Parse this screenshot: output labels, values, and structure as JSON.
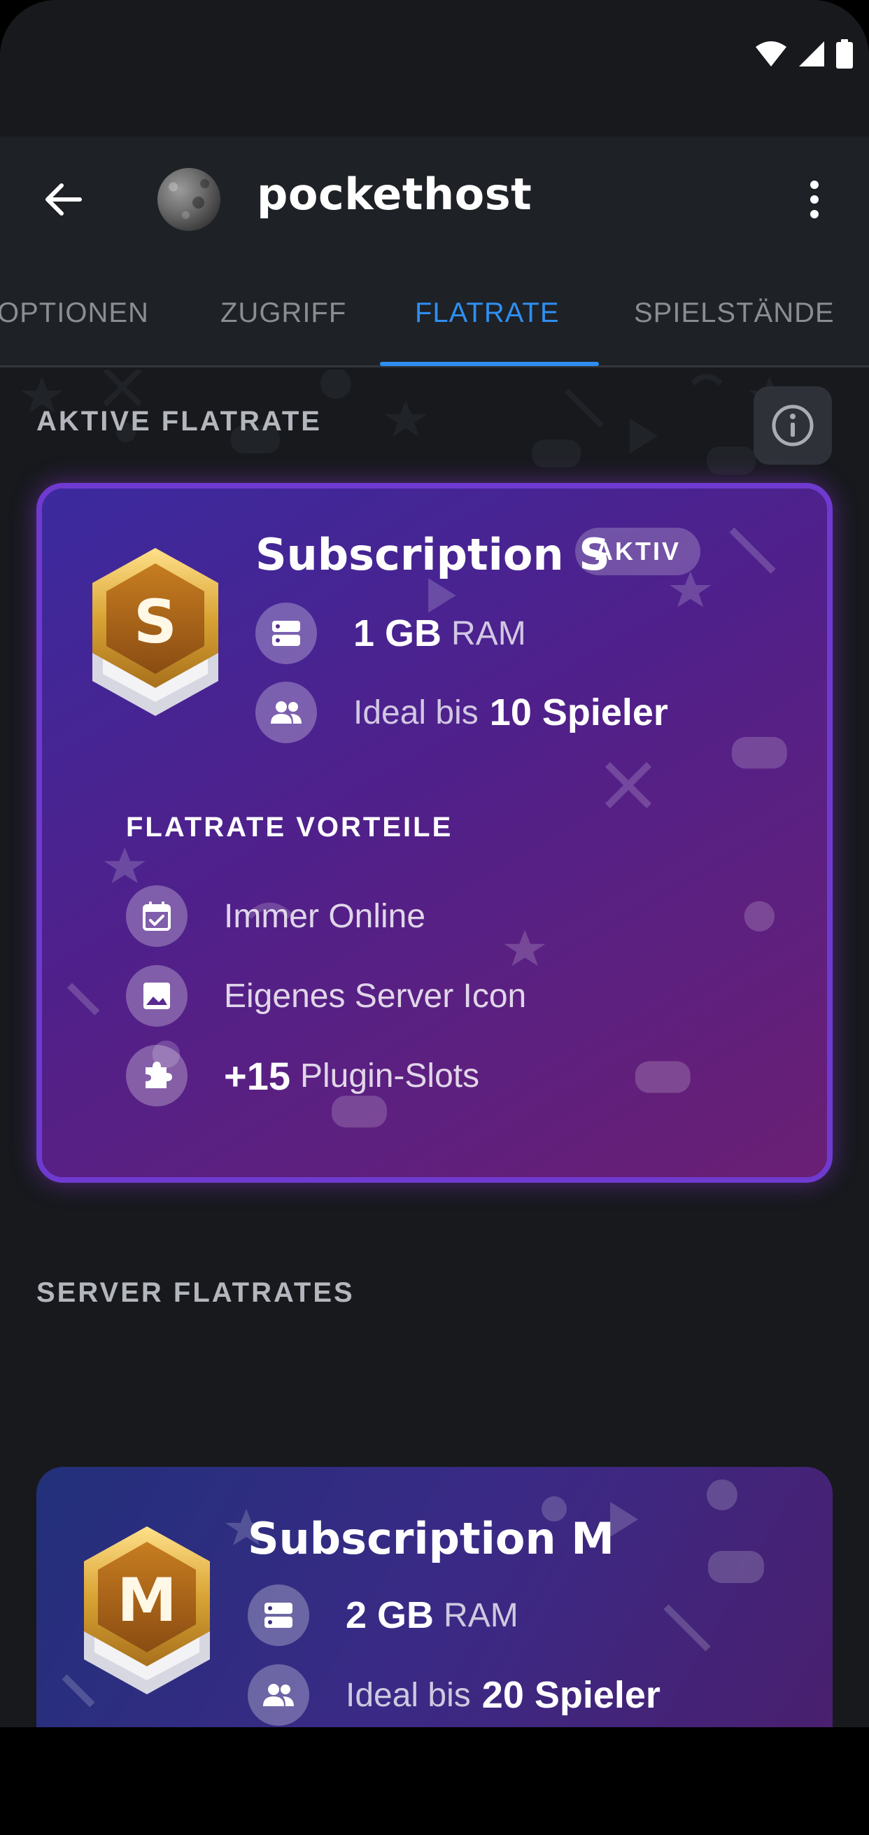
{
  "app_bar": {
    "title": "pockethost"
  },
  "tabs": [
    {
      "label": "OPTIONEN",
      "active": false
    },
    {
      "label": "ZUGRIFF",
      "active": false
    },
    {
      "label": "FLATRATE",
      "active": true
    },
    {
      "label": "SPIELSTÄNDE",
      "active": false
    }
  ],
  "active_section": {
    "label": "AKTIVE FLATRATE",
    "plan": {
      "badge_letter": "S",
      "title": "Subscription S",
      "status": "AKTIV",
      "ram_value": "1 GB",
      "ram_unit": "RAM",
      "players_prefix": "Ideal bis",
      "players_value": "10 Spieler"
    },
    "benefits_label": "FLATRATE VORTEILE",
    "benefits": {
      "always_online": "Immer Online",
      "server_icon": "Eigenes Server Icon",
      "plugin_count": "+15",
      "plugin_label": "Plugin-Slots"
    }
  },
  "server_section": {
    "label": "SERVER FLATRATES",
    "plan": {
      "badge_letter": "M",
      "title": "Subscription M",
      "ram_value": "2 GB",
      "ram_unit": "RAM",
      "players_prefix": "Ideal bis",
      "players_value": "20 Spieler"
    }
  },
  "colors": {
    "background": "#17191d",
    "accent": "#2e8ff0",
    "card_gradient_start": "#3b2a9e",
    "card_gradient_end": "#6a1f74",
    "badge_gold": "#d9a434"
  }
}
